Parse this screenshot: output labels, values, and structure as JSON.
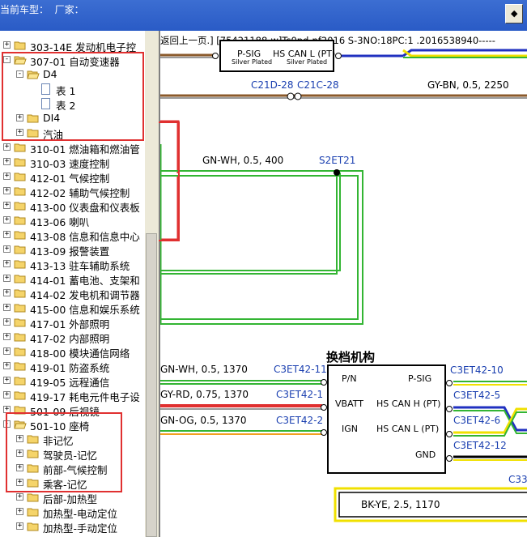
{
  "titlebar": {
    "text": "当前车型：  厂家："
  },
  "window_button": {
    "icon": "restore-icon",
    "glyph": "◆"
  },
  "tree": {
    "items": [
      {
        "label": "303-14E 发动机电子控",
        "level": 0,
        "expander": "+",
        "icon": "folder-icon"
      },
      {
        "label": "307-01 自动变速器",
        "level": 0,
        "expander": "-",
        "icon": "folder-open-icon"
      },
      {
        "label": "D4",
        "level": 1,
        "expander": "-",
        "icon": "folder-open-icon"
      },
      {
        "label": "表 1",
        "level": 2,
        "expander": "",
        "icon": "document-icon"
      },
      {
        "label": "表 2",
        "level": 2,
        "expander": "",
        "icon": "document-icon"
      },
      {
        "label": "DI4",
        "level": 1,
        "expander": "+",
        "icon": "folder-icon"
      },
      {
        "label": "汽油",
        "level": 1,
        "expander": "+",
        "icon": "folder-icon"
      },
      {
        "label": "310-01 燃油箱和燃油管",
        "level": 0,
        "expander": "+",
        "icon": "folder-icon"
      },
      {
        "label": "310-03 速度控制",
        "level": 0,
        "expander": "+",
        "icon": "folder-icon"
      },
      {
        "label": "412-01 气候控制",
        "level": 0,
        "expander": "+",
        "icon": "folder-icon"
      },
      {
        "label": "412-02 辅助气候控制",
        "level": 0,
        "expander": "+",
        "icon": "folder-icon"
      },
      {
        "label": "413-00 仪表盘和仪表板",
        "level": 0,
        "expander": "+",
        "icon": "folder-icon"
      },
      {
        "label": "413-06 喇叭",
        "level": 0,
        "expander": "+",
        "icon": "folder-icon"
      },
      {
        "label": "413-08 信息和信息中心",
        "level": 0,
        "expander": "+",
        "icon": "folder-icon"
      },
      {
        "label": "413-09 报警装置",
        "level": 0,
        "expander": "+",
        "icon": "folder-icon"
      },
      {
        "label": "413-13 驻车辅助系统",
        "level": 0,
        "expander": "+",
        "icon": "folder-icon"
      },
      {
        "label": "414-01 蓄电池、支架和",
        "level": 0,
        "expander": "+",
        "icon": "folder-icon"
      },
      {
        "label": "414-02 发电机和调节器",
        "level": 0,
        "expander": "+",
        "icon": "folder-icon"
      },
      {
        "label": "415-00 信息和娱乐系统",
        "level": 0,
        "expander": "+",
        "icon": "folder-icon"
      },
      {
        "label": "417-01 外部照明",
        "level": 0,
        "expander": "+",
        "icon": "folder-icon"
      },
      {
        "label": "417-02 内部照明",
        "level": 0,
        "expander": "+",
        "icon": "folder-icon"
      },
      {
        "label": "418-00 模块通信网络",
        "level": 0,
        "expander": "+",
        "icon": "folder-icon"
      },
      {
        "label": "419-01 防盗系统",
        "level": 0,
        "expander": "+",
        "icon": "folder-icon"
      },
      {
        "label": "419-05 远程通信",
        "level": 0,
        "expander": "+",
        "icon": "folder-icon"
      },
      {
        "label": "419-17 耗电元件电子设",
        "level": 0,
        "expander": "+",
        "icon": "folder-icon"
      },
      {
        "label": "501-09 后视镜",
        "level": 0,
        "expander": "+",
        "icon": "folder-icon"
      },
      {
        "label": "501-10 座椅",
        "level": 0,
        "expander": "-",
        "icon": "folder-open-icon"
      },
      {
        "label": "非记忆",
        "level": 1,
        "expander": "+",
        "icon": "folder-icon"
      },
      {
        "label": "驾驶员-记忆",
        "level": 1,
        "expander": "+",
        "icon": "folder-icon"
      },
      {
        "label": "前部-气候控制",
        "level": 1,
        "expander": "+",
        "icon": "folder-icon"
      },
      {
        "label": "乘客-记忆",
        "level": 1,
        "expander": "+",
        "icon": "folder-icon"
      },
      {
        "label": "后部-加热型",
        "level": 1,
        "expander": "+",
        "icon": "folder-icon"
      },
      {
        "label": "加热型-电动定位",
        "level": 1,
        "expander": "+",
        "icon": "folder-icon"
      },
      {
        "label": "加热型-手动定位",
        "level": 1,
        "expander": "+",
        "icon": "folder-icon"
      }
    ]
  },
  "diagram": {
    "header_text": "返回上一页.] [75421188-w]Ts0pd-nf2016 S-3NO:18PC:1 .2016538940-----",
    "top_connector": {
      "pins": [
        "P-SIG",
        "HS CAN L (PT)"
      ],
      "notes": [
        "Silver Plated",
        "Silver Plated"
      ]
    },
    "wire_labels": {
      "c21d": "C21D-28",
      "c21c": "C21C-28",
      "gy_bn": "GY-BN,  0.5,  2250",
      "gn_wh_400": "GN-WH,  0.5,  400",
      "s2et21": "S2ET21",
      "gn_wh_1370": "GN-WH,  0.5,  1370",
      "gy_rd": "GY-RD,  0.75,  1370",
      "gn_og": "GN-OG,  0.5,  1370",
      "bk_ye": "BK-YE,  2.5,  1170"
    },
    "module": {
      "title": "换档机构",
      "left_pins": [
        "P/N",
        "VBATT",
        "IGN"
      ],
      "right_pins": [
        "P-SIG",
        "HS CAN H (PT)",
        "HS CAN L (PT)",
        "GND"
      ]
    },
    "connector_labels": {
      "left": [
        "C3ET42-11",
        "C3ET42-1",
        "C3ET42-2"
      ],
      "right": [
        "C3ET42-10",
        "C3ET42-5",
        "C3ET42-6",
        "C3ET42-12"
      ],
      "edge": "C33"
    },
    "colors": {
      "green": "#33b533",
      "brown": "#8b5a2b",
      "grey": "#9a9a9a",
      "red": "#e03030",
      "yellow": "#f0e000",
      "blue": "#2030c0",
      "black": "#000000",
      "label_blue": "#1a3fb0",
      "highlight_red": "#e03030"
    }
  }
}
